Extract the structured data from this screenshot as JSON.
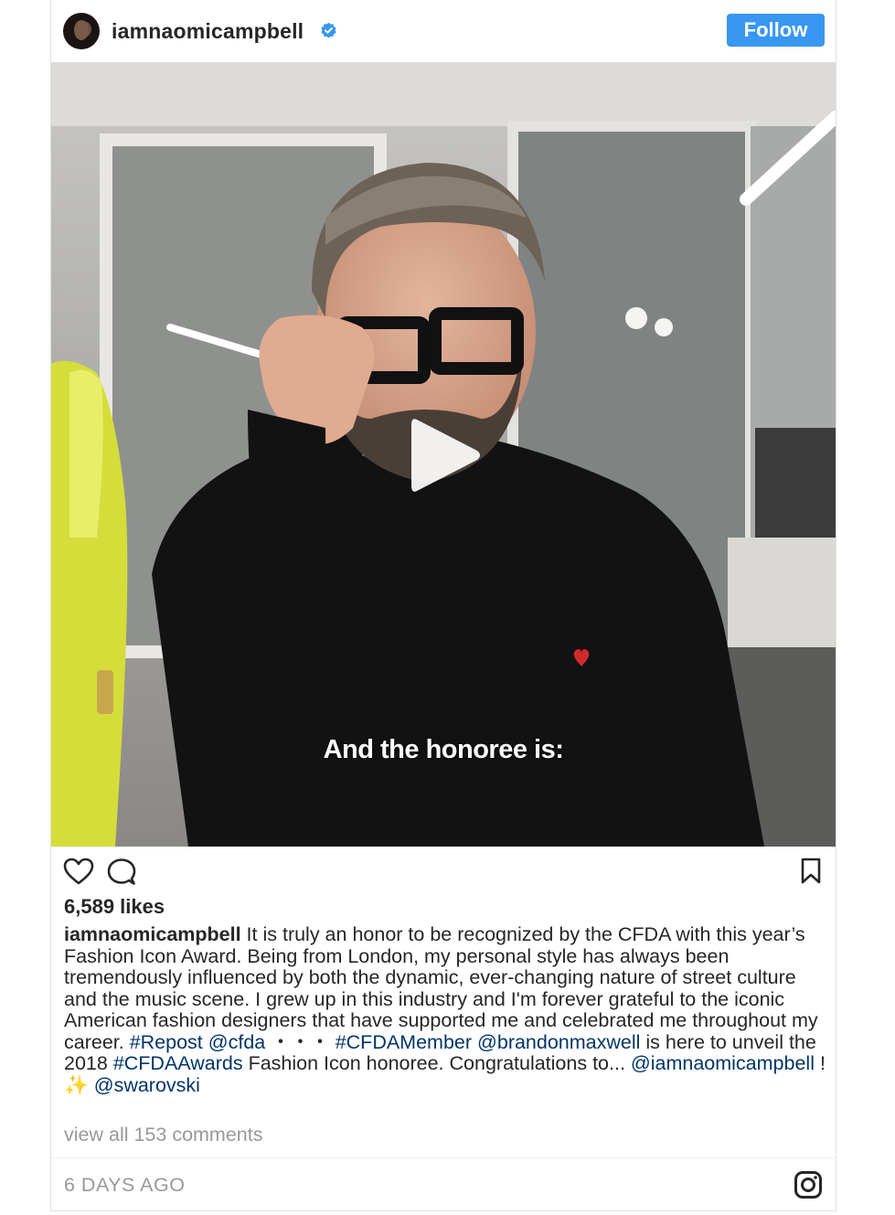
{
  "header": {
    "username": "iamnaomicampbell",
    "follow_label": "Follow"
  },
  "media": {
    "subtitle": "And the honoree is:",
    "type": "video"
  },
  "stats": {
    "likes": "6,589 likes"
  },
  "caption": {
    "username": "iamnaomicampbell",
    "segments": [
      {
        "text": " It is truly an honor to be recognized by the CFDA with this year’s Fashion Icon Award. Being from London, my personal style has always been tremendously influenced by both the dynamic, ever-changing nature of street culture and the music scene. I grew up in this industry and I'm forever grateful to the iconic American fashion designers that have supported me and celebrated me throughout my career. ",
        "type": "text"
      },
      {
        "text": "#Repost",
        "type": "tag"
      },
      {
        "text": " ",
        "type": "text"
      },
      {
        "text": "@cfda",
        "type": "tag"
      },
      {
        "text": " ・・・ ",
        "type": "text"
      },
      {
        "text": "#CFDAMember",
        "type": "tag"
      },
      {
        "text": " ",
        "type": "text"
      },
      {
        "text": "@brandonmaxwell",
        "type": "tag"
      },
      {
        "text": " is here to unveil the 2018 ",
        "type": "text"
      },
      {
        "text": "#CFDAAwards",
        "type": "tag"
      },
      {
        "text": " Fashion Icon honoree. Congratulations to... ",
        "type": "text"
      },
      {
        "text": "@iamnaomicampbell",
        "type": "tag"
      },
      {
        "text": " !✨ ",
        "type": "text"
      },
      {
        "text": "@swarovski",
        "type": "tag"
      }
    ]
  },
  "comments": {
    "label": "view all 153 comments"
  },
  "footer": {
    "timestamp": "6 DAYS AGO"
  },
  "colors": {
    "follow_button": "#3897f0",
    "tag": "#003569",
    "muted": "#999999",
    "text": "#262626"
  },
  "icons": [
    "verified-badge-icon",
    "play-icon",
    "heart-icon",
    "comment-icon",
    "bookmark-icon",
    "instagram-icon"
  ]
}
